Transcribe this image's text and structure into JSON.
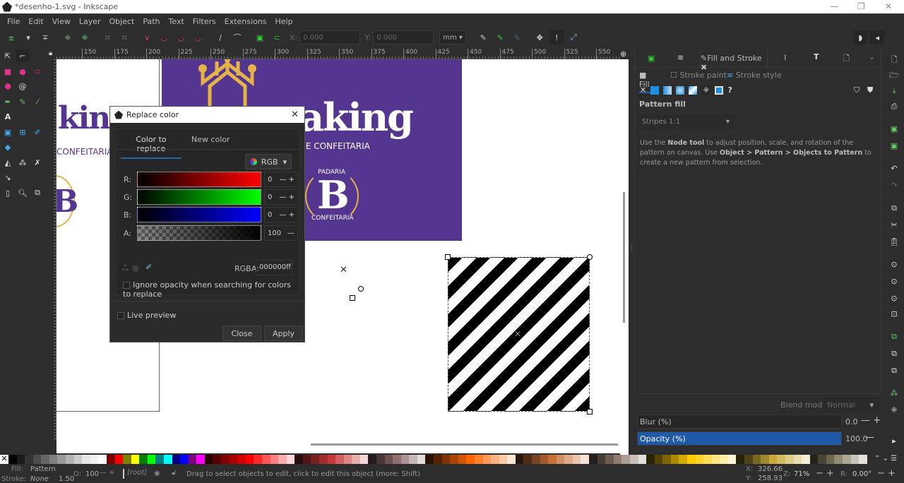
{
  "window": {
    "title": "*desenho-1.svg - Inkscape",
    "minimize": "—",
    "maximize": "❐",
    "close": "✕"
  },
  "menu": [
    "File",
    "Edit",
    "View",
    "Layer",
    "Object",
    "Path",
    "Text",
    "Filters",
    "Extensions",
    "Help"
  ],
  "toolcontrols": {
    "x_label": "X:",
    "x_value": "0.000",
    "y_label": "Y:",
    "y_value": "0.000",
    "unit": "mm"
  },
  "ruler_ticks": [
    "150",
    "175",
    "200",
    "225",
    "250",
    "275",
    "300",
    "325",
    "350",
    "375",
    "400",
    "425",
    "450",
    "475",
    "500",
    "525",
    "550"
  ],
  "canvas": {
    "left_logo_text": "kin",
    "left_logo_sub": "CONFEITARIA",
    "left_badge": "B",
    "logo_text": "aking",
    "logo_sub": "RIA E CONFEITARIA",
    "badge_letter": "B",
    "badge_top": "PADARIA",
    "badge_bottom": "CONFEITARIA",
    "purple": "#54358f",
    "gold": "#e6b24a"
  },
  "dialog": {
    "title": "Replace color",
    "close": "✕",
    "tabs": [
      "Color to replace",
      "New color"
    ],
    "active_tab": 0,
    "mode": "RGB",
    "channels": [
      {
        "label": "R:",
        "value": "0"
      },
      {
        "label": "G:",
        "value": "0"
      },
      {
        "label": "B:",
        "value": "0"
      },
      {
        "label": "A:",
        "value": "100"
      }
    ],
    "rgba_label": "RGBA:",
    "rgba_value": "000000ff",
    "ignore_opacity": "Ignore opacity when searching for colors to replace",
    "live_preview": "Live preview",
    "close_btn": "Close",
    "apply_btn": "Apply"
  },
  "dock": {
    "tab_label": "Fill and Stroke",
    "subtabs": [
      "Fill",
      "Stroke paint",
      "Stroke style"
    ],
    "pattern_heading": "Pattern fill",
    "pattern_value": "Stripes 1:1",
    "help_parts": [
      "Use the ",
      "Node tool",
      " to adjust position, scale, and rotation of the pattern on canvas. Use ",
      "Object > Pattern > Objects to Pattern",
      " to create a new pattern from selection."
    ],
    "blend_label": "Blend mode:",
    "blend_value": "Normal",
    "blur_label": "Blur (%)",
    "blur_value": "0.0",
    "opacity_label": "Opacity (%)",
    "opacity_value": "100.0",
    "accent": "#1f5aa8"
  },
  "status": {
    "fill_label": "Fill:",
    "fill_value": "Pattern",
    "stroke_label": "Stroke:",
    "stroke_value": "None",
    "stroke_width": "1.50",
    "opacity_label": "O:",
    "opacity_value": "100",
    "layer": "[root]",
    "message": "Drag to select objects to edit, click to edit this object (more: Shift)",
    "x_label": "X:",
    "x_value": "326.66",
    "y_label": "Y:",
    "y_value": "258.93",
    "zoom_label": "Z:",
    "zoom_value": "71%",
    "rot_label": "R:",
    "rot_value": "0.00°"
  },
  "palette": [
    "#000000",
    "#1a1a1a",
    "#333333",
    "#4d4d4d",
    "#666666",
    "#808080",
    "#999999",
    "#b3b3b3",
    "#cccccc",
    "#e6e6e6",
    "#f2f2f2",
    "#ffffff",
    "#800000",
    "#ff0000",
    "#808000",
    "#ffff00",
    "#008000",
    "#00ff00",
    "#008080",
    "#00ffff",
    "#000080",
    "#0000ff",
    "#800080",
    "#ff00ff",
    "#2b0000",
    "#550000",
    "#800000",
    "#aa0000",
    "#d40000",
    "#ff0000",
    "#ff2a2a",
    "#ff5555",
    "#ff8080",
    "#ffaaaa",
    "#ffd5d5",
    "#280b0b",
    "#501616",
    "#782121",
    "#a02c2c",
    "#c83737",
    "#d35f5f",
    "#de8787",
    "#e9afaf",
    "#f4d7d7",
    "#241c1c",
    "#483737",
    "#6c5353",
    "#916f6f",
    "#ac9393",
    "#c8b7b7",
    "#e3dbdb",
    "#2b1100",
    "#552200",
    "#803300",
    "#aa4400",
    "#d45500",
    "#ff6600",
    "#ff7f2a",
    "#ff9955",
    "#ffb380",
    "#ffccaa",
    "#ffe6d5",
    "#28170b",
    "#502d16",
    "#784421",
    "#a05a2c",
    "#c87137",
    "#d38d5f",
    "#deaa87",
    "#e9c6af",
    "#f4e3d7",
    "#241f1c",
    "#483e37",
    "#6c5d53",
    "#917c6f",
    "#ac9d93",
    "#c8beb7",
    "#e3dedb",
    "#2b2200",
    "#554400",
    "#806600",
    "#aa8800",
    "#d4aa00",
    "#ffcc00",
    "#ffd42a",
    "#ffdd55",
    "#ffe680",
    "#ffeeaa",
    "#fff6d5",
    "#28220b",
    "#504416",
    "#786721",
    "#a0892c",
    "#c8ab37",
    "#d3bc5f",
    "#decd87",
    "#e9ddaf",
    "#f4eed7",
    "#24221c",
    "#484537",
    "#6c6753",
    "#918a6f",
    "#aca793",
    "#c8c4b7",
    "#e3e2db"
  ]
}
